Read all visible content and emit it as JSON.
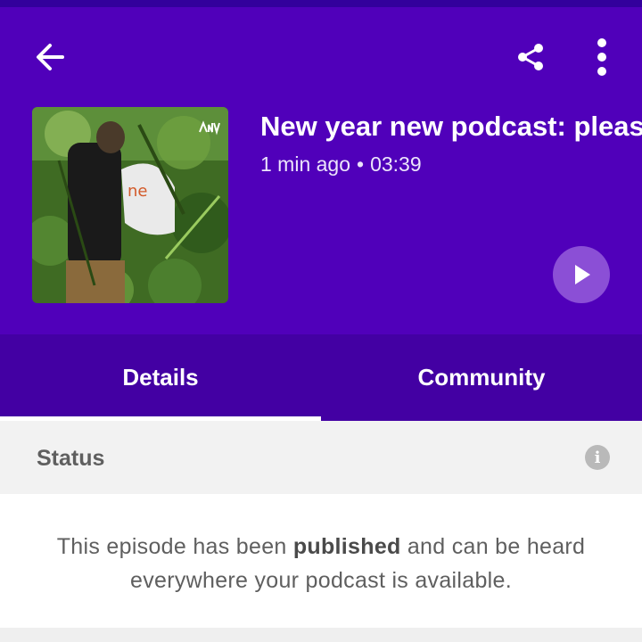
{
  "header": {
    "title": "New year new podcast: pleas",
    "time_ago": "1 min ago",
    "separator": "•",
    "duration": "03:39"
  },
  "icons": {
    "back": "back-arrow-icon",
    "share": "share-icon",
    "more": "more-vertical-icon",
    "play": "play-icon",
    "info": "info-icon",
    "badge": "anchor-logo-icon"
  },
  "tabs": [
    {
      "label": "Details",
      "selected": true
    },
    {
      "label": "Community",
      "selected": false
    }
  ],
  "status": {
    "heading": "Status",
    "info_glyph": "i",
    "message_pre": "This episode has been ",
    "message_bold": "published",
    "message_post": " and can be heard everywhere your podcast is available."
  },
  "colors": {
    "header_bg": "#5000ba",
    "tabs_bg": "#4300a3",
    "play_bg": "#8b4fd6"
  }
}
